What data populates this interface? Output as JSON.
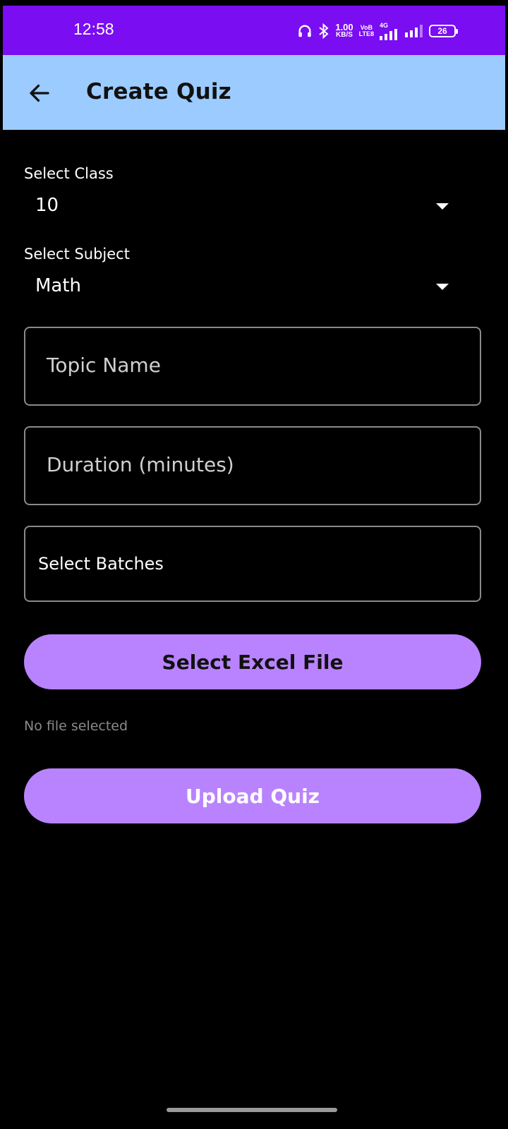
{
  "status_bar": {
    "time": "12:58",
    "net_speed_value": "1.00",
    "net_speed_unit": "KB/S",
    "volte_top": "VoB",
    "volte_bottom": "LTE8",
    "network_type": "4G",
    "battery": "26",
    "background_color": "#7a0df2"
  },
  "app_bar": {
    "title": "Create Quiz",
    "back_icon": "arrow-left-icon",
    "background_color": "#9ccbff"
  },
  "form": {
    "class_label": "Select Class",
    "class_value": "10",
    "subject_label": "Select Subject",
    "subject_value": "Math",
    "topic_placeholder": "Topic Name",
    "duration_placeholder": "Duration (minutes)",
    "batches_label": "Select Batches",
    "select_file_button": "Select Excel File",
    "file_status": "No file selected",
    "upload_button": "Upload Quiz",
    "button_color": "#b983ff"
  }
}
